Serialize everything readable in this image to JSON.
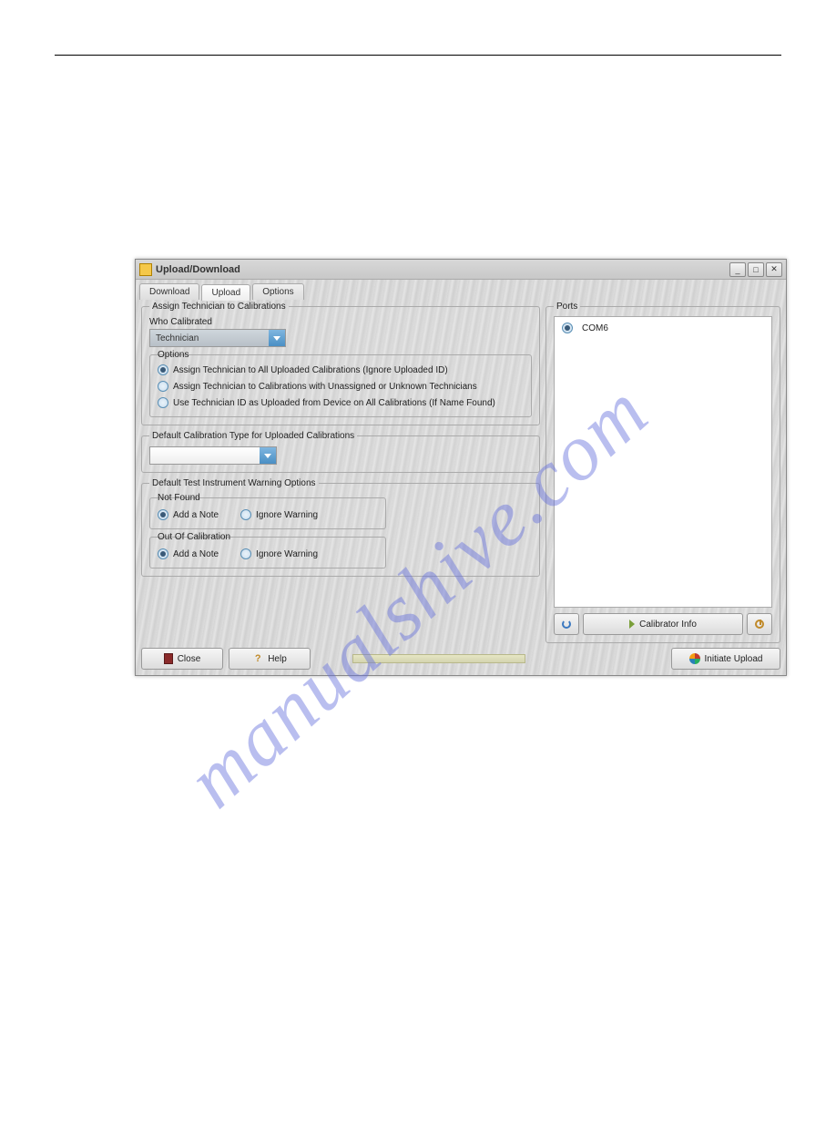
{
  "watermark": "manualshive.com",
  "window": {
    "title": "Upload/Download",
    "tabs": [
      "Download",
      "Upload",
      "Options"
    ],
    "active_tab": 1
  },
  "assign": {
    "legend": "Assign Technician to Calibrations",
    "who_label": "Who Calibrated",
    "who_value": "Technician",
    "options_legend": "Options",
    "opts": [
      "Assign Technician to All Uploaded Calibrations (Ignore Uploaded ID)",
      "Assign Technician to Calibrations with Unassigned or Unknown Technicians",
      "Use Technician ID as Uploaded from Device on All Calibrations (If Name Found)"
    ],
    "opts_selected": 0
  },
  "caltype": {
    "legend": "Default Calibration Type for Uploaded Calibrations",
    "value": ""
  },
  "warnopts": {
    "legend": "Default Test Instrument Warning Options",
    "notfound_legend": "Not Found",
    "outofcal_legend": "Out Of Calibration",
    "choice_add": "Add a Note",
    "choice_ignore": "Ignore Warning",
    "notfound_sel": 0,
    "outofcal_sel": 0
  },
  "ports": {
    "legend": "Ports",
    "items": [
      "COM6"
    ],
    "selected": 0,
    "buttons": {
      "calibrator_info": "Calibrator Info"
    }
  },
  "footer": {
    "close": "Close",
    "help": "Help",
    "initiate": "Initiate Upload"
  }
}
